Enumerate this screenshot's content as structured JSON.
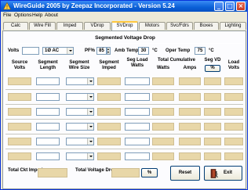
{
  "window": {
    "title": "WireGuide 2005 by Zeepaz Incorporated - Version 5.24",
    "minimize": "_",
    "maximize": "□",
    "close": "×"
  },
  "menu": [
    "File",
    "Options",
    "Help",
    "About"
  ],
  "tabs": [
    "Calc",
    "Wire Fill",
    "Imped",
    "VDrop",
    "SVDrop",
    "Motors",
    "Svc/Fdrs",
    "Boxes",
    "Lighting"
  ],
  "active_tab": "SVDrop",
  "panel": {
    "heading": "Segmented Voltage Drop",
    "volts_label": "Volts",
    "volts_value": "",
    "phase_value": "1Ø AC",
    "pf_label": "PF%",
    "pf_value": "85",
    "amb_temp_label": "Amb Temp",
    "amb_temp_value": "30",
    "amb_temp_unit": "°C",
    "oper_temp_label": "Oper Temp",
    "oper_temp_value": "75",
    "oper_temp_unit": "°C"
  },
  "columns": {
    "source_volts": "Source Volts",
    "segment_length": "Segment Length",
    "segment_wire_size": "Segment Wire Size",
    "segment_imped": "Segment Imped",
    "seg_load_watts": "Seg Load Watts",
    "total_cumulative": "Total Cumulative",
    "watts": "Watts",
    "amps": "Amps",
    "seg_vd": "Seg VD",
    "seg_vd_pct": "%",
    "load_volts": "Load Volts"
  },
  "rows": [
    {
      "length": "",
      "wire_size": ""
    },
    {
      "length": "",
      "wire_size": ""
    },
    {
      "length": "",
      "wire_size": ""
    },
    {
      "length": "",
      "wire_size": ""
    },
    {
      "length": "",
      "wire_size": ""
    },
    {
      "length": "",
      "wire_size": ""
    }
  ],
  "footer": {
    "total_ckt_imped": "Total Ckt Imped",
    "total_voltage_drop": "Total Voltage Drop",
    "pct": "%",
    "reset": "Reset",
    "exit": "Exit"
  },
  "colors": {
    "title_bar": "#0a5fd6",
    "readout": "#e8d7a8",
    "panel": "#fcfcfe",
    "window": "#ece9d8"
  },
  "icons": {
    "app": "app-icon",
    "exit": "exit-door-icon"
  }
}
